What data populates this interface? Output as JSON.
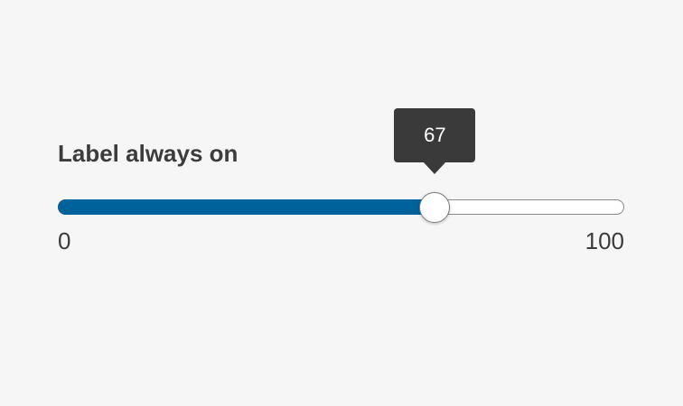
{
  "slider": {
    "label": "Label always on",
    "min": 0,
    "max": 100,
    "value": 67,
    "min_label": "0",
    "max_label": "100",
    "tooltip_value": "67",
    "fill_color": "#00629b",
    "tooltip_color": "#3a3a3a"
  }
}
